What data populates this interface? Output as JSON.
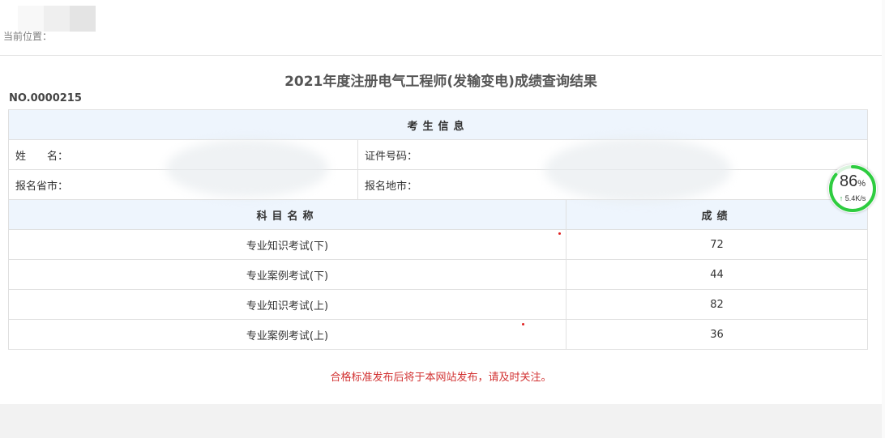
{
  "breadcrumb": "当前位置：",
  "title": "2021年度注册电气工程师(发输变电)成绩查询结果",
  "number": "NO.0000215",
  "info_header": "考生信息",
  "fields": {
    "name_label": "姓　　名：",
    "id_label": "证件号码：",
    "province_label": "报名省市：",
    "city_label": "报名地市："
  },
  "scores_header": {
    "subject": "科目名称",
    "score": "成绩"
  },
  "rows": [
    {
      "subject": "专业知识考试(下)",
      "score": "72"
    },
    {
      "subject": "专业案例考试(下)",
      "score": "44"
    },
    {
      "subject": "专业知识考试(上)",
      "score": "82"
    },
    {
      "subject": "专业案例考试(上)",
      "score": "36"
    }
  ],
  "notice": "合格标准发布后将于本网站发布，请及时关注。",
  "speed_widget": {
    "percent": "86",
    "percent_unit": "%",
    "arrow": "↑",
    "rate": "5.4K/s",
    "percent_value": 86,
    "ring_color": "#2ecc40"
  }
}
